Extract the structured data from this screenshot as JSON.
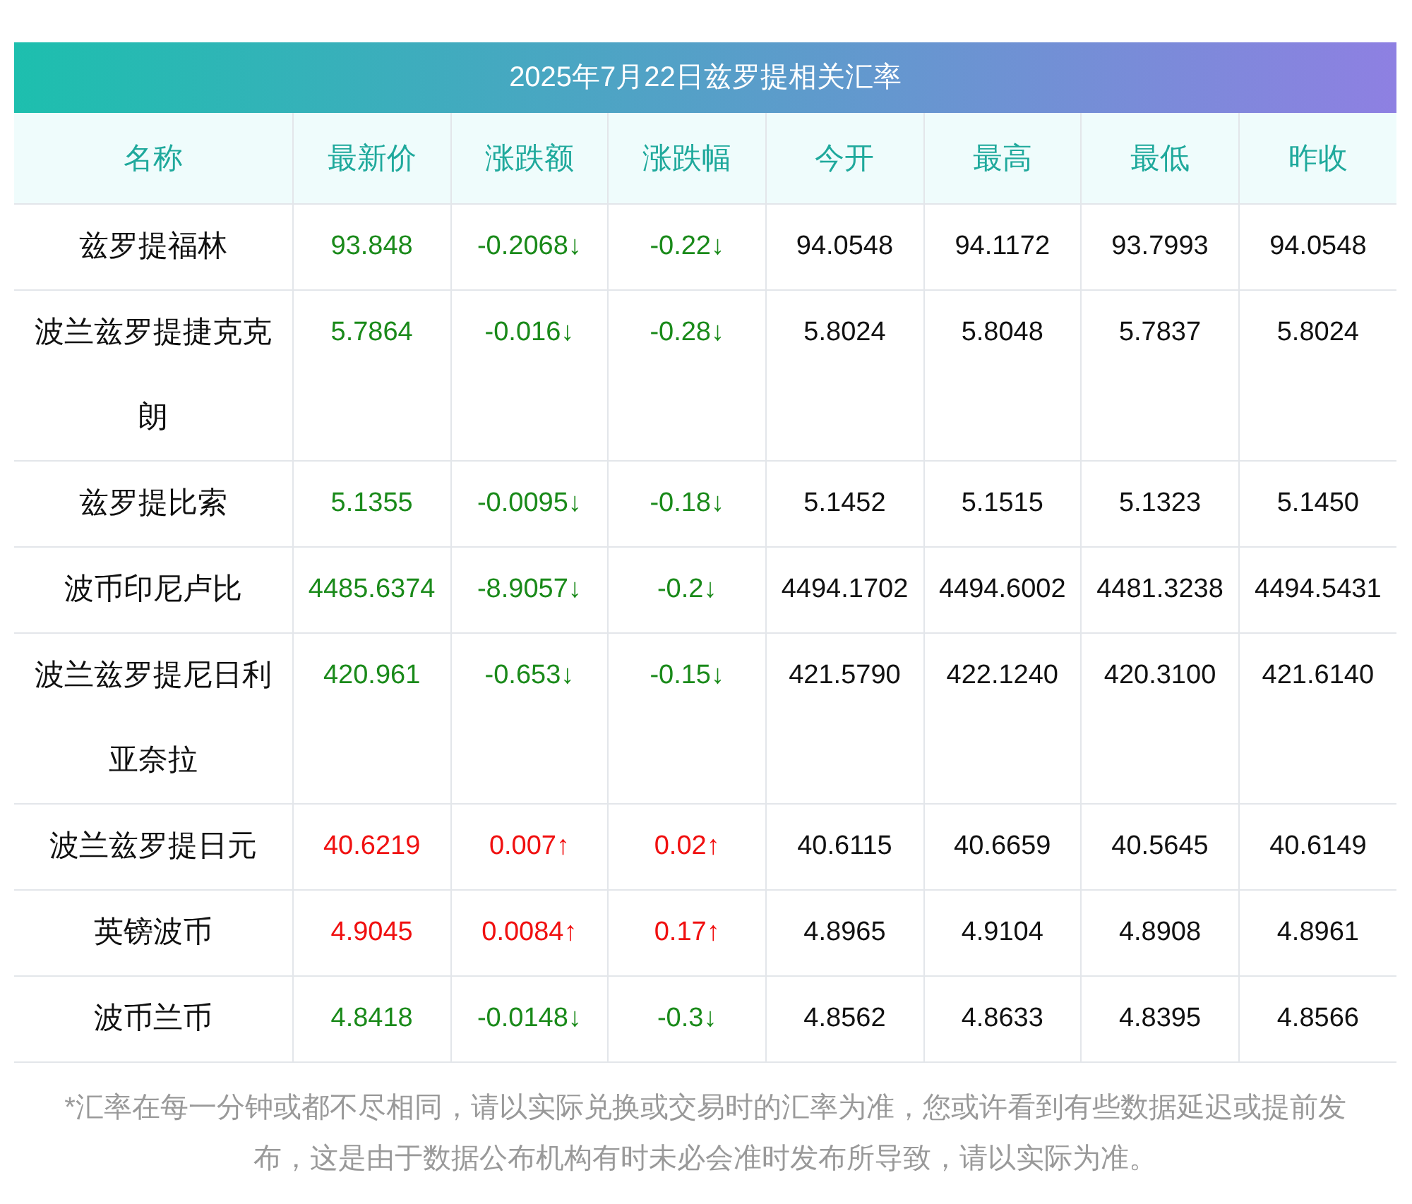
{
  "title": "2025年7月22日兹罗提相关汇率",
  "columns": [
    "名称",
    "最新价",
    "涨跌额",
    "涨跌幅",
    "今开",
    "最高",
    "最低",
    "昨收"
  ],
  "rows": [
    {
      "name": "兹罗提福林",
      "rising": false,
      "latest": "93.848",
      "change": "-0.2068↓",
      "change_pct": "-0.22↓",
      "open": "94.0548",
      "high": "94.1172",
      "low": "93.7993",
      "prev_close": "94.0548"
    },
    {
      "name": "波兰兹罗提捷克克朗",
      "rising": false,
      "latest": "5.7864",
      "change": "-0.016↓",
      "change_pct": "-0.28↓",
      "open": "5.8024",
      "high": "5.8048",
      "low": "5.7837",
      "prev_close": "5.8024"
    },
    {
      "name": "兹罗提比索",
      "rising": false,
      "latest": "5.1355",
      "change": "-0.0095↓",
      "change_pct": "-0.18↓",
      "open": "5.1452",
      "high": "5.1515",
      "low": "5.1323",
      "prev_close": "5.1450"
    },
    {
      "name": "波币印尼卢比",
      "rising": false,
      "latest": "4485.6374",
      "change": "-8.9057↓",
      "change_pct": "-0.2↓",
      "open": "4494.1702",
      "high": "4494.6002",
      "low": "4481.3238",
      "prev_close": "4494.5431"
    },
    {
      "name": "波兰兹罗提尼日利亚奈拉",
      "rising": false,
      "latest": "420.961",
      "change": "-0.653↓",
      "change_pct": "-0.15↓",
      "open": "421.5790",
      "high": "422.1240",
      "low": "420.3100",
      "prev_close": "421.6140"
    },
    {
      "name": "波兰兹罗提日元",
      "rising": true,
      "latest": "40.6219",
      "change": "0.007↑",
      "change_pct": "0.02↑",
      "open": "40.6115",
      "high": "40.6659",
      "low": "40.5645",
      "prev_close": "40.6149"
    },
    {
      "name": "英镑波币",
      "rising": true,
      "latest": "4.9045",
      "change": "0.0084↑",
      "change_pct": "0.17↑",
      "open": "4.8965",
      "high": "4.9104",
      "low": "4.8908",
      "prev_close": "4.8961"
    },
    {
      "name": "波币兰币",
      "rising": false,
      "latest": "4.8418",
      "change": "-0.0148↓",
      "change_pct": "-0.3↓",
      "open": "4.8562",
      "high": "4.8633",
      "low": "4.8395",
      "prev_close": "4.8566"
    }
  ],
  "footnote": "*汇率在每一分钟或都不尽相同，请以实际兑换或交易时的汇率为准，您或许看到有些数据延迟或提前发布，这是由于数据公布机构有时未必会准时发布所导致，请以实际为准。"
}
